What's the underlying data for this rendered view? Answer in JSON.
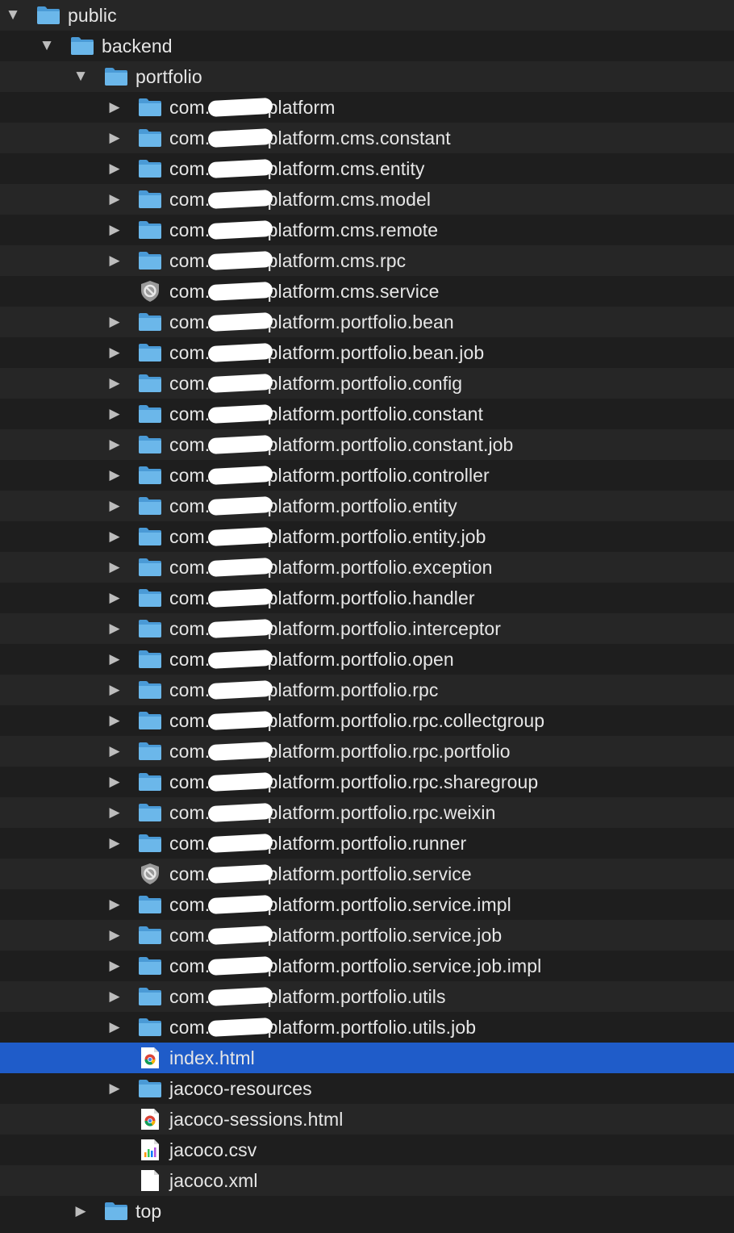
{
  "tree": {
    "rows": [
      {
        "label": "public",
        "type": "folder",
        "disclosure": "expanded",
        "depth": 0,
        "icon": "folder-icon"
      },
      {
        "label": "backend",
        "type": "folder",
        "disclosure": "expanded",
        "depth": 1,
        "icon": "folder-icon"
      },
      {
        "label": "portfolio",
        "type": "folder",
        "disclosure": "expanded",
        "depth": 2,
        "icon": "folder-icon"
      },
      {
        "label": "com.          .platform",
        "type": "folder",
        "disclosure": "collapsed",
        "depth": 3,
        "icon": "folder-icon",
        "redacted": true
      },
      {
        "label": "com.          .platform.cms.constant",
        "type": "folder",
        "disclosure": "collapsed",
        "depth": 3,
        "icon": "folder-icon",
        "redacted": true
      },
      {
        "label": "com.          .platform.cms.entity",
        "type": "folder",
        "disclosure": "collapsed",
        "depth": 3,
        "icon": "folder-icon",
        "redacted": true
      },
      {
        "label": "com.          .platform.cms.model",
        "type": "folder",
        "disclosure": "collapsed",
        "depth": 3,
        "icon": "folder-icon",
        "redacted": true
      },
      {
        "label": "com.          .platform.cms.remote",
        "type": "folder",
        "disclosure": "collapsed",
        "depth": 3,
        "icon": "folder-icon",
        "redacted": true
      },
      {
        "label": "com.          .platform.cms.rpc",
        "type": "folder",
        "disclosure": "collapsed",
        "depth": 3,
        "icon": "folder-icon",
        "redacted": true
      },
      {
        "label": "com.          .platform.cms.service",
        "type": "restricted",
        "disclosure": "none",
        "depth": 3,
        "icon": "restricted-folder-icon",
        "redacted": true
      },
      {
        "label": "com.          .platform.portfolio.bean",
        "type": "folder",
        "disclosure": "collapsed",
        "depth": 3,
        "icon": "folder-icon",
        "redacted": true
      },
      {
        "label": "com.          .platform.portfolio.bean.job",
        "type": "folder",
        "disclosure": "collapsed",
        "depth": 3,
        "icon": "folder-icon",
        "redacted": true
      },
      {
        "label": "com.          .platform.portfolio.config",
        "type": "folder",
        "disclosure": "collapsed",
        "depth": 3,
        "icon": "folder-icon",
        "redacted": true
      },
      {
        "label": "com.          .platform.portfolio.constant",
        "type": "folder",
        "disclosure": "collapsed",
        "depth": 3,
        "icon": "folder-icon",
        "redacted": true
      },
      {
        "label": "com.          .platform.portfolio.constant.job",
        "type": "folder",
        "disclosure": "collapsed",
        "depth": 3,
        "icon": "folder-icon",
        "redacted": true
      },
      {
        "label": "com.          .platform.portfolio.controller",
        "type": "folder",
        "disclosure": "collapsed",
        "depth": 3,
        "icon": "folder-icon",
        "redacted": true
      },
      {
        "label": "com.          .platform.portfolio.entity",
        "type": "folder",
        "disclosure": "collapsed",
        "depth": 3,
        "icon": "folder-icon",
        "redacted": true
      },
      {
        "label": "com.          .platform.portfolio.entity.job",
        "type": "folder",
        "disclosure": "collapsed",
        "depth": 3,
        "icon": "folder-icon",
        "redacted": true
      },
      {
        "label": "com.          .platform.portfolio.exception",
        "type": "folder",
        "disclosure": "collapsed",
        "depth": 3,
        "icon": "folder-icon",
        "redacted": true
      },
      {
        "label": "com.          .platform.portfolio.handler",
        "type": "folder",
        "disclosure": "collapsed",
        "depth": 3,
        "icon": "folder-icon",
        "redacted": true
      },
      {
        "label": "com.          .platform.portfolio.interceptor",
        "type": "folder",
        "disclosure": "collapsed",
        "depth": 3,
        "icon": "folder-icon",
        "redacted": true
      },
      {
        "label": "com.          .platform.portfolio.open",
        "type": "folder",
        "disclosure": "collapsed",
        "depth": 3,
        "icon": "folder-icon",
        "redacted": true
      },
      {
        "label": "com.          .platform.portfolio.rpc",
        "type": "folder",
        "disclosure": "collapsed",
        "depth": 3,
        "icon": "folder-icon",
        "redacted": true
      },
      {
        "label": "com.          .platform.portfolio.rpc.collectgroup",
        "type": "folder",
        "disclosure": "collapsed",
        "depth": 3,
        "icon": "folder-icon",
        "redacted": true
      },
      {
        "label": "com.          .platform.portfolio.rpc.portfolio",
        "type": "folder",
        "disclosure": "collapsed",
        "depth": 3,
        "icon": "folder-icon",
        "redacted": true
      },
      {
        "label": "com.          .platform.portfolio.rpc.sharegroup",
        "type": "folder",
        "disclosure": "collapsed",
        "depth": 3,
        "icon": "folder-icon",
        "redacted": true
      },
      {
        "label": "com.          .platform.portfolio.rpc.weixin",
        "type": "folder",
        "disclosure": "collapsed",
        "depth": 3,
        "icon": "folder-icon",
        "redacted": true
      },
      {
        "label": "com.          .platform.portfolio.runner",
        "type": "folder",
        "disclosure": "collapsed",
        "depth": 3,
        "icon": "folder-icon",
        "redacted": true
      },
      {
        "label": "com.          .platform.portfolio.service",
        "type": "restricted",
        "disclosure": "none",
        "depth": 3,
        "icon": "restricted-folder-icon",
        "redacted": true
      },
      {
        "label": "com.          .platform.portfolio.service.impl",
        "type": "folder",
        "disclosure": "collapsed",
        "depth": 3,
        "icon": "folder-icon",
        "redacted": true
      },
      {
        "label": "com.          .platform.portfolio.service.job",
        "type": "folder",
        "disclosure": "collapsed",
        "depth": 3,
        "icon": "folder-icon",
        "redacted": true
      },
      {
        "label": "com.          .platform.portfolio.service.job.impl",
        "type": "folder",
        "disclosure": "collapsed",
        "depth": 3,
        "icon": "folder-icon",
        "redacted": true
      },
      {
        "label": "com.          .platform.portfolio.utils",
        "type": "folder",
        "disclosure": "collapsed",
        "depth": 3,
        "icon": "folder-icon",
        "redacted": true
      },
      {
        "label": "com.          .platform.portfolio.utils.job",
        "type": "folder",
        "disclosure": "collapsed",
        "depth": 3,
        "icon": "folder-icon",
        "redacted": true
      },
      {
        "label": "index.html",
        "type": "html",
        "disclosure": "none",
        "depth": 3,
        "icon": "chrome-html-file-icon",
        "selected": true
      },
      {
        "label": "jacoco-resources",
        "type": "folder",
        "disclosure": "collapsed",
        "depth": 3,
        "icon": "folder-icon"
      },
      {
        "label": "jacoco-sessions.html",
        "type": "html",
        "disclosure": "none",
        "depth": 3,
        "icon": "chrome-html-file-icon"
      },
      {
        "label": "jacoco.csv",
        "type": "csv",
        "disclosure": "none",
        "depth": 3,
        "icon": "csv-file-icon"
      },
      {
        "label": "jacoco.xml",
        "type": "blank",
        "disclosure": "none",
        "depth": 3,
        "icon": "blank-file-icon"
      },
      {
        "label": "top",
        "type": "folder",
        "disclosure": "collapsed",
        "depth": 2,
        "icon": "folder-icon"
      }
    ]
  },
  "colors": {
    "selection": "#1f5cc9",
    "row_even": "#1e1e1e",
    "row_odd": "#262626",
    "folder": "#5aa9e0",
    "text": "#e6e6e6"
  }
}
